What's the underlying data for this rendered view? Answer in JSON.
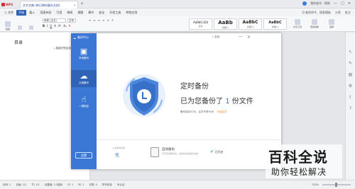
{
  "titlebar": {
    "app": "WPS",
    "doc_tab": "文字文稿 (带日期的备份文档)",
    "tab_close": "×",
    "tab_add": "+",
    "user": "我的账号 · 帮助",
    "buttons": [
      "—",
      "□",
      "×"
    ]
  },
  "menubar": {
    "file": "三 文件",
    "items": [
      "开始",
      "插入",
      "页面布局",
      "引用",
      "审阅",
      "视图",
      "章节",
      "安全",
      "开发工具",
      "特色应用"
    ],
    "active_index": 0,
    "right": [
      "Q 查找命令、搜索模板",
      "分享",
      "批注"
    ]
  },
  "ribbon": {
    "paste": "粘贴",
    "font": "宋体 (正文)",
    "size": "五号",
    "format_buttons": [
      "B",
      "I",
      "U",
      "A",
      "X²",
      "X₂",
      "A"
    ],
    "para_buttons": [
      "≡",
      "≡",
      "≡",
      "≡",
      "≡",
      "↕"
    ],
    "styles": [
      {
        "sample": "AaBbCcDd",
        "caption": "正文"
      },
      {
        "sample": "AaBb",
        "caption": "标题 1"
      },
      {
        "sample": "AaBbC",
        "caption": "标题 2"
      },
      {
        "sample": "AaBbC",
        "caption": "标题 3"
      }
    ],
    "right_tools": [
      "文字工具",
      "查找替换",
      "选择"
    ]
  },
  "leftpane": {
    "title": "目录",
    "close": "×",
    "item": "智能识别目录"
  },
  "dialog": {
    "side_title": "备份中心",
    "side_items": [
      "本地备份",
      "云端备份",
      "一键恢复"
    ],
    "settings": "设置",
    "support": "○ 支持",
    "minimize": "—",
    "close": "×",
    "main_title": "定时备份",
    "sub_prefix": "已为您备份了",
    "file_count": "1",
    "sub_suffix": "份文件",
    "note": "备份保存30天，会员专享90天",
    "note_link": "升级会员",
    "recent_label": "上次备份时间",
    "recent_value": "无",
    "auto_title": "自动备份",
    "auto_desc": "打开自动备份后，系统将自动备份文档",
    "auto_status": "已开启"
  },
  "statusbar": {
    "items": [
      "页码: 1",
      "页面: 1/1",
      "节: 1/1",
      "设置值: 2.5厘米",
      "行: 1",
      "列: 1",
      "字数: 0",
      "拼写检查",
      "未认证"
    ],
    "zoom": "120%",
    "zoom_value": 0.45
  },
  "watermark": {
    "title": "百科全说",
    "subtitle": "助你轻松解决"
  }
}
